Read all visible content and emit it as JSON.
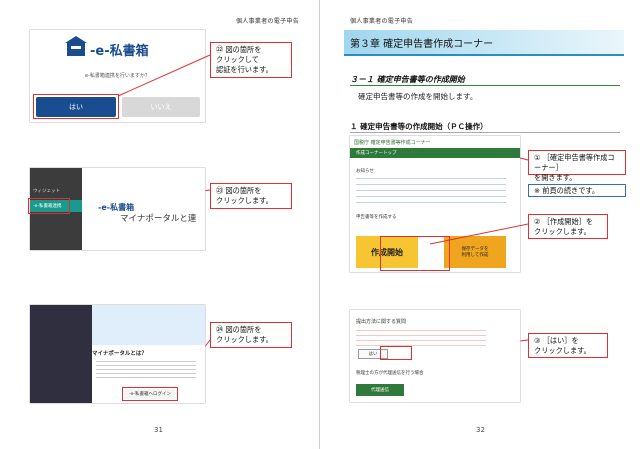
{
  "book_header": "個人事業者の電子申告",
  "left_page": {
    "page_number": "31",
    "step22": {
      "logo_text": "-e-私書箱",
      "question": "e-私書箱連携を行いますか？",
      "yes_button": "はい",
      "no_button": "いいえ",
      "callout": "㉒ 図の箇所を\nクリックして\n認証を行います。"
    },
    "step23": {
      "sidebar_top_label": "ウィジェット",
      "sidebar_item": "-e-私書箱連携",
      "logo_text": "-e-私書箱",
      "portal_text": "マイナポータルと連",
      "callout": "㉓ 図の箇所を\nクリックします。"
    },
    "step24": {
      "heading": "マイナポータルとは？",
      "button_text": "-e-私書箱ヘログイン",
      "callout": "㉔ 図の箇所を\nクリックします。"
    }
  },
  "right_page": {
    "page_number": "32",
    "chapter_title": "第３章 確定申告書作成コーナー",
    "section_title": "３－１ 確定申告書等の作成開始",
    "section_body": "確定申告書等の作成を開始します。",
    "subsection_title": "１ 確定申告書等の作成開始（ＰＣ操作）",
    "screen1": {
      "site_title": "国税庁 確定申告書等作成コーナー",
      "nav_label": "作成コーナートップ",
      "notice_label": "お知らせ",
      "start_label": "申告書等を作成する",
      "start_button": "作成開始",
      "saved_button": "保存データを\n利用して作成"
    },
    "callout1": "① ［確定申告書等作成コーナー］\nを開きます。",
    "note": "※ 前頁の続きです。",
    "callout2": "② ［作成開始］を\nクリックします。",
    "screen2": {
      "heading": "提出方法に関する質問",
      "yes_button": "はい",
      "lower_heading": "税理士の方が代理送信を行う場合",
      "lower_button": "代理送信"
    },
    "callout3": "③ ［はい］を\nクリックします。"
  },
  "colors": {
    "accent_red": "#e03030",
    "navy": "#1a4d8f",
    "teal": "#1a9a8c",
    "green": "#2f8a3a",
    "orange": "#f0a51e",
    "yellow": "#f7c531"
  }
}
